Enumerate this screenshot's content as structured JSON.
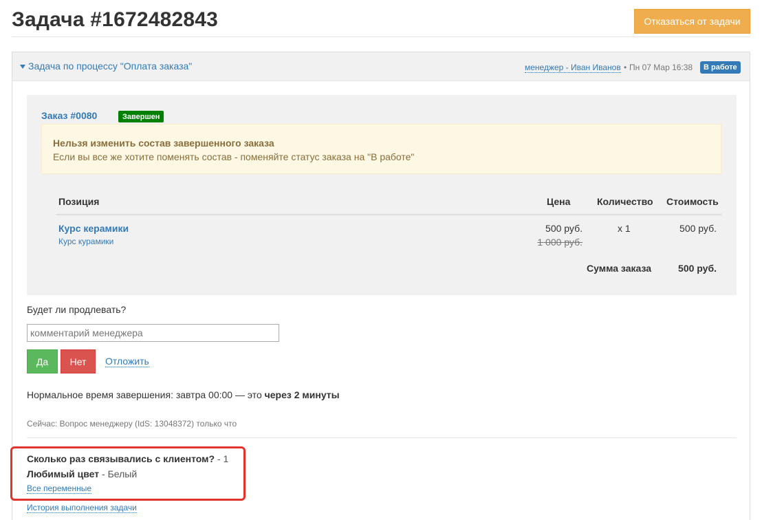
{
  "header": {
    "title": "Задача #1672482843",
    "abandon_label": "Отказаться от задачи"
  },
  "task_panel": {
    "process_label": "Задача по процессу \"Оплата заказа\"",
    "manager_label": "менеджер - Иван Иванов",
    "dot": "•",
    "date": "Пн 07 Мар 16:38",
    "status": "В работе",
    "status_color": "#337ab7"
  },
  "order": {
    "title": "Заказ #0080",
    "status": "Завершен",
    "status_color": "#008000",
    "alert_title": "Нельзя изменить состав завершенного заказа",
    "alert_text": "Если вы все же хотите поменять состав - поменяйте статус заказа на \"В работе\"",
    "columns": {
      "position": "Позиция",
      "price": "Цена",
      "quantity": "Количество",
      "cost": "Стоимость"
    },
    "items": [
      {
        "name": "Курс керамики",
        "subtitle": "Курс курамики",
        "price": "500 руб.",
        "old_price": "1 000 руб.",
        "quantity": "x 1",
        "cost": "500 руб."
      }
    ],
    "total_label": "Сумма заказа",
    "total_value": "500 руб."
  },
  "form": {
    "question": "Будет ли продлевать?",
    "comment_placeholder": "комментарий менеджера",
    "yes_label": "Да",
    "no_label": "Нет",
    "postpone_label": "Отложить"
  },
  "deadline": {
    "text": "Нормальное время завершения: завтра 00:00 — это ",
    "emphasis": "через 2 минуты"
  },
  "now_text": "Сейчас: Вопрос менеджеру (IdS: 13048372) только что",
  "variables": {
    "items": [
      {
        "label": "Сколько раз связывались с клиентом?",
        "value": " - 1"
      },
      {
        "label": "Любимый цвет",
        "value": " - Белый"
      }
    ],
    "all_label": "Все переменные",
    "highlight_color": "#e0352c"
  },
  "history_label": "История выполнения задачи"
}
